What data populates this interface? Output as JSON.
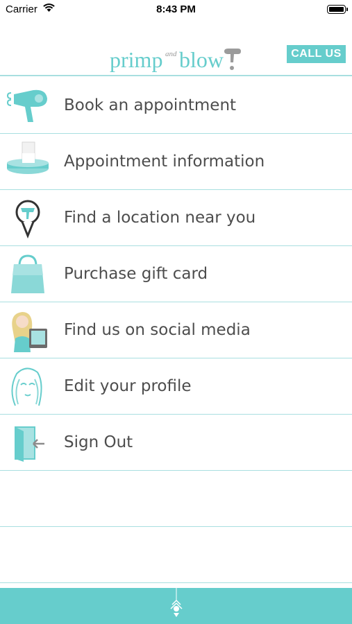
{
  "status_bar": {
    "carrier": "Carrier",
    "time": "8:43 PM"
  },
  "header": {
    "logo": {
      "primp": "primp",
      "and": "and",
      "blow": "blow"
    },
    "call_label": "CALL US"
  },
  "menu": {
    "items": [
      {
        "label": "Book an appointment",
        "icon": "hair-dryer-icon"
      },
      {
        "label": "Appointment information",
        "icon": "appointment-card-icon"
      },
      {
        "label": "Find a location near you",
        "icon": "map-pin-icon"
      },
      {
        "label": "Purchase gift card",
        "icon": "shopping-bag-icon"
      },
      {
        "label": "Find us on social media",
        "icon": "social-girl-icon"
      },
      {
        "label": "Edit your profile",
        "icon": "profile-face-icon"
      },
      {
        "label": "Sign Out",
        "icon": "door-exit-icon"
      }
    ]
  },
  "colors": {
    "accent": "#66cdcc",
    "divider": "#a8dfe0",
    "text": "#4d4d4d"
  }
}
